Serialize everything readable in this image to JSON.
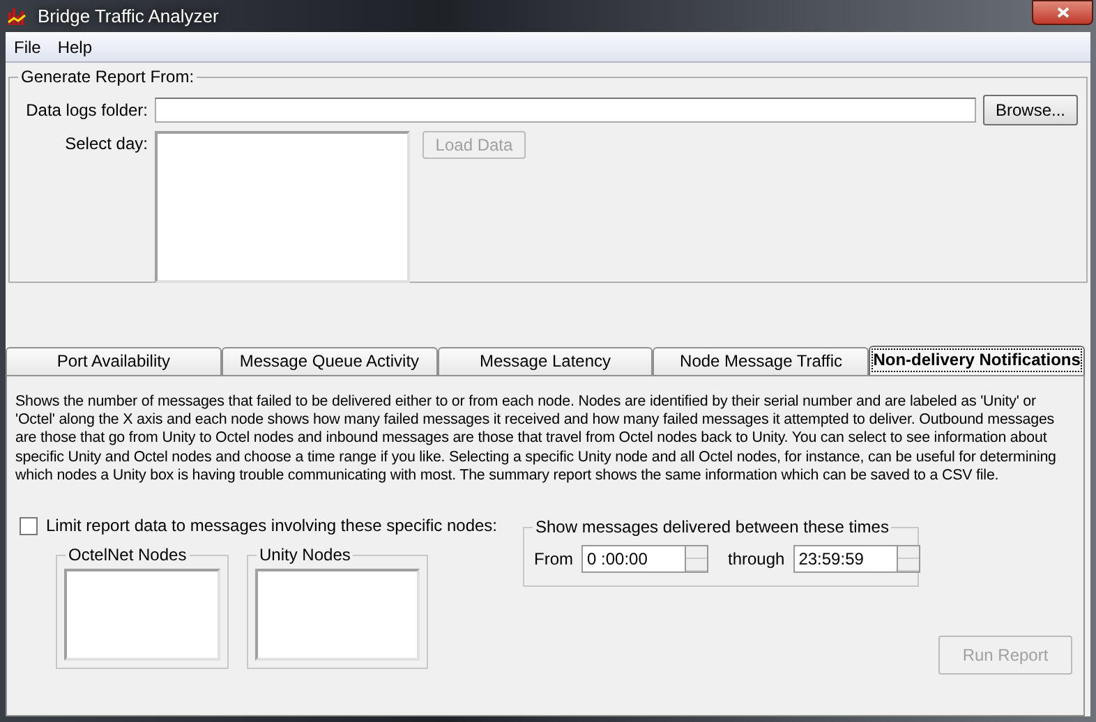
{
  "window": {
    "title": "Bridge Traffic Analyzer"
  },
  "menu": [
    "File",
    "Help"
  ],
  "report_source": {
    "title": "Generate Report From:",
    "folder_label": "Data logs folder:",
    "browse_button": "Browse...",
    "day_label": "Select day:",
    "load_button": {
      "label": "Load Data",
      "disabled": true
    }
  },
  "tabs": [
    {
      "label": "Port Availability",
      "selected": false
    },
    {
      "label": "Message Queue Activity",
      "selected": false
    },
    {
      "label": "Message Latency",
      "selected": false
    },
    {
      "label": "Node Message Traffic",
      "selected": false
    },
    {
      "label": "Non-delivery Notifications",
      "selected": true
    }
  ],
  "description": "Shows the number of messages that failed to be delivered either to or from each node.  Nodes are identified by their serial number and are labeled as 'Unity' or 'Octel' along the X axis and each node shows how many failed messages it received and how many failed messages it attempted to deliver.  Outbound messages are those that go from Unity to Octel nodes and inbound messages are those that travel from Octel nodes back to Unity.  You can select to see information about specific Unity and Octel nodes and choose a time range if you like.  Selecting a specific Unity node and all Octel nodes, for instance, can be useful for determining which nodes a Unity box is having trouble communicating with most.  The summary report shows the same information which can be saved to a CSV file.",
  "limit": {
    "label": "Limit report data to messages involving these specific nodes:",
    "checked": false
  },
  "node_lists": [
    "OctelNet Nodes",
    "Unity Nodes"
  ],
  "time_range": {
    "title": "Show messages delivered between these times",
    "from_label": "From",
    "from_value": "0 :00:00",
    "through_label": "through",
    "through_value": "23:59:59"
  },
  "run_button": {
    "label": "Run Report",
    "disabled": true
  }
}
